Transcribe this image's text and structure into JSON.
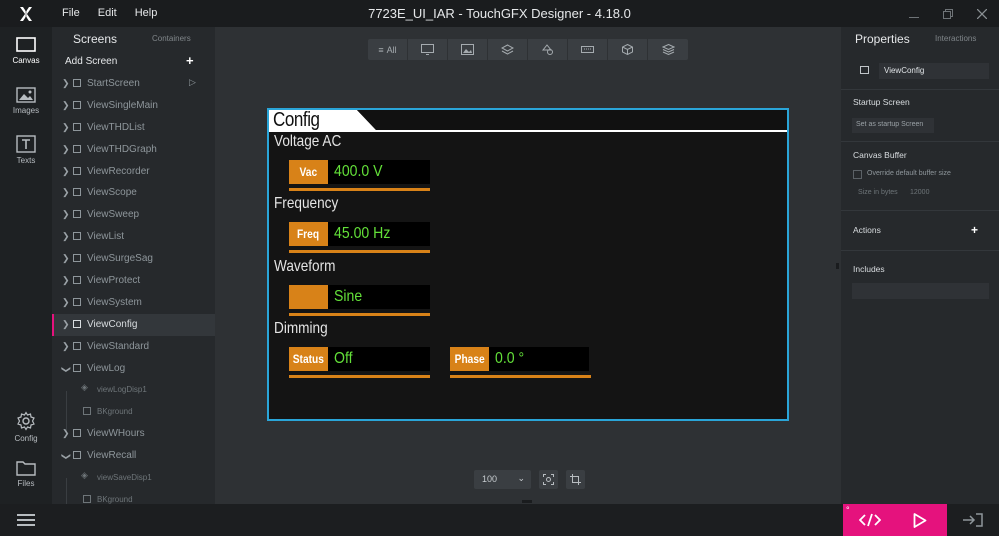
{
  "app": {
    "title": "7723E_UI_IAR - TouchGFX Designer - 4.18.0",
    "menu": [
      "File",
      "Edit",
      "Help"
    ]
  },
  "leftnav": {
    "canvas": "Canvas",
    "images": "Images",
    "texts": "Texts",
    "config": "Config",
    "files": "Files"
  },
  "screens_panel": {
    "tab_screens": "Screens",
    "tab_containers": "Containers",
    "add_screen": "Add Screen",
    "items": [
      {
        "name": "StartScreen"
      },
      {
        "name": "ViewSingleMain"
      },
      {
        "name": "ViewTHDList"
      },
      {
        "name": "ViewTHDGraph"
      },
      {
        "name": "ViewRecorder"
      },
      {
        "name": "ViewScope"
      },
      {
        "name": "ViewSweep"
      },
      {
        "name": "ViewList"
      },
      {
        "name": "ViewSurgeSag"
      },
      {
        "name": "ViewProtect"
      },
      {
        "name": "ViewSystem"
      },
      {
        "name": "ViewConfig"
      },
      {
        "name": "ViewStandard"
      },
      {
        "name": "ViewLog"
      },
      {
        "name": "viewLogDisp1"
      },
      {
        "name": "BKground"
      },
      {
        "name": "ViewWHours"
      },
      {
        "name": "ViewRecall"
      },
      {
        "name": "viewSaveDisp1"
      },
      {
        "name": "BKground"
      }
    ]
  },
  "canvas": {
    "filter_all": "All",
    "zoom": "100",
    "screen": {
      "title": "Config",
      "voltage_label": "Voltage AC",
      "vac_tag": "Vac",
      "vac_value": "400.0 V",
      "frequency_label": "Frequency",
      "freq_tag": "Freq",
      "freq_value": "45.00 Hz",
      "waveform_label": "Waveform",
      "waveform_tag": "",
      "waveform_value": "Sine",
      "dimming_label": "Dimming",
      "status_tag": "Status",
      "status_value": "Off",
      "phase_tag": "Phase",
      "phase_value": "0.0 °"
    },
    "colors": {
      "accent": "#d88218",
      "value_text": "#63e039",
      "selection": "#2aa5d8",
      "brand": "#e5127d"
    }
  },
  "properties": {
    "tab_properties": "Properties",
    "tab_interactions": "Interactions",
    "name": "ViewConfig",
    "startup_screen": "Startup Screen",
    "set_startup": "Set as startup Screen",
    "canvas_buffer": "Canvas Buffer",
    "override_buffer": "Override default buffer size",
    "size_in_bytes": "Size in bytes",
    "size_value": "12000",
    "actions": "Actions",
    "includes": "Includes"
  },
  "bottombar": {
    "degree": "°"
  }
}
